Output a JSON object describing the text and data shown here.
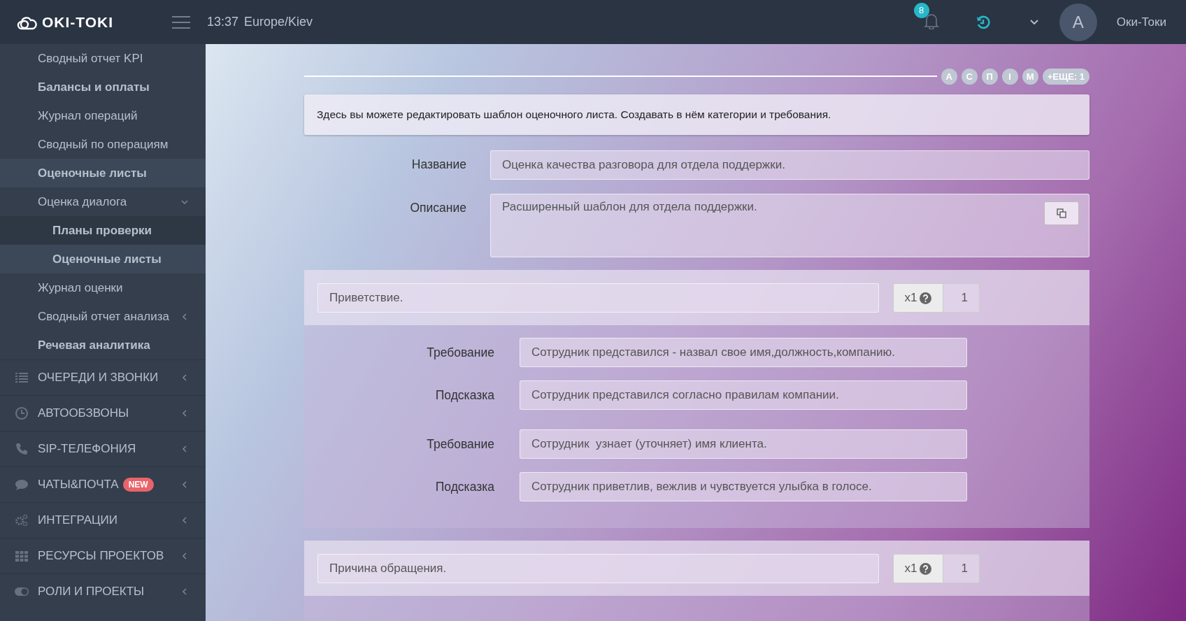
{
  "header": {
    "logo": "OKI-TOKI",
    "time": "13:37",
    "timezone": "Europe/Kiev",
    "notifications": "8",
    "avatar_initial": "A",
    "user_name": "Оки-Токи"
  },
  "sidebar": {
    "items": [
      {
        "label": "Сводный отчет KPI",
        "kind": "link",
        "selected": false
      },
      {
        "label": "Балансы и оплаты",
        "kind": "heading",
        "selected": false
      },
      {
        "label": "Журнал операций",
        "kind": "link",
        "selected": false
      },
      {
        "label": "Сводный по операциям",
        "kind": "link",
        "selected": false
      },
      {
        "label": "Оценочные листы",
        "kind": "heading",
        "selected": true
      },
      {
        "label": "Оценка диалога",
        "kind": "link",
        "selected": false,
        "expanded": true,
        "children": [
          {
            "label": "Планы проверки",
            "kind": "heading",
            "selected": false
          },
          {
            "label": "Оценочные листы",
            "kind": "heading",
            "selected": true
          }
        ]
      },
      {
        "label": "Журнал оценки",
        "kind": "link",
        "selected": false
      },
      {
        "label": "Сводный отчет анализа",
        "kind": "link",
        "selected": false,
        "expanded": false
      },
      {
        "label": "Речевая аналитика",
        "kind": "heading",
        "selected": false
      }
    ],
    "sections": [
      {
        "label": "ОЧЕРЕДИ И ЗВОНКИ"
      },
      {
        "label": "АВТООБЗВОНЫ"
      },
      {
        "label": "SIP-ТЕЛЕФОНИЯ"
      },
      {
        "label": "ЧАТЫ&ПОЧТА",
        "badge": "NEW"
      },
      {
        "label": "ИНТЕГРАЦИИ"
      },
      {
        "label": "РЕСУРСЫ ПРОЕКТОВ"
      },
      {
        "label": "РОЛИ И ПРОЕКТЫ"
      }
    ]
  },
  "participants": {
    "chips": [
      "А",
      "С",
      "П",
      "І",
      "М"
    ],
    "more": "+ЕЩЕ: 1"
  },
  "info": "Здесь вы можете редактировать шаблон оценочного листа. Создавать в нём категории и требования.",
  "form": {
    "name_label": "Название",
    "name": "Оценка качества разговора для отдела поддержки.",
    "description_label": "Описание",
    "description": "Расширенный шаблон для отдела поддержки."
  },
  "categories": [
    {
      "title": "Приветствие.",
      "weight_label": "x1",
      "weight": "1",
      "requirements": [
        {
          "fields": [
            {
              "label": "Требование",
              "value": "Сотрудник представился - назвал свое имя,должность,компанию."
            },
            {
              "label": "Подсказка",
              "value": "Сотрудник представился согласно правилам компании."
            }
          ]
        },
        {
          "fields": [
            {
              "label": "Требование",
              "value": "Сотрудник  узнает (уточняет) имя клиента."
            },
            {
              "label": "Подсказка",
              "value": "Сотрудник приветлив, вежлив и чувствуется улыбка в голосе."
            }
          ]
        }
      ]
    },
    {
      "title": "Причина обращения.",
      "weight_label": "x1",
      "weight": "1"
    }
  ]
}
